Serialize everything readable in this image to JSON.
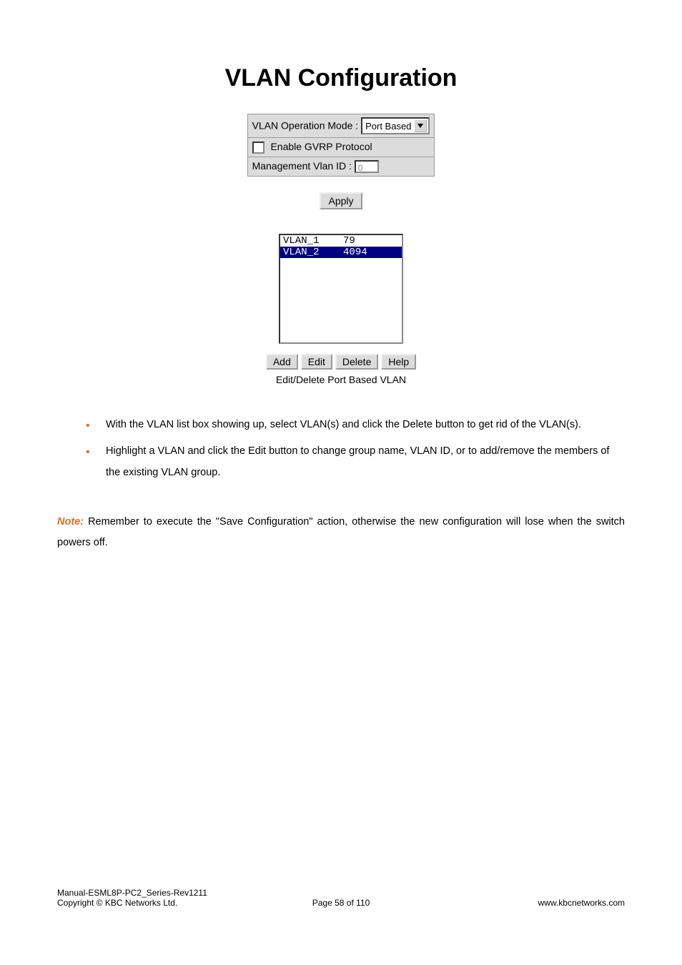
{
  "title": "VLAN Configuration",
  "config": {
    "op_mode_label": "VLAN Operation Mode :",
    "op_mode_value": "Port Based",
    "gvrp_label": "Enable GVRP Protocol",
    "gvrp_checked": false,
    "mvid_label": "Management Vlan ID :",
    "mvid_value": "0",
    "apply_label": "Apply"
  },
  "listbox": {
    "items": [
      {
        "text": "VLAN_1    79",
        "selected": false
      },
      {
        "text": "VLAN_2    4094",
        "selected": true
      }
    ]
  },
  "buttons": {
    "add": "Add",
    "edit": "Edit",
    "delete": "Delete",
    "help": "Help"
  },
  "caption": "Edit/Delete Port Based VLAN",
  "bullets": [
    "With the VLAN list box showing up, select VLAN(s) and click the Delete button to get rid of the VLAN(s).",
    "Highlight a VLAN and click the Edit button to change group name, VLAN ID, or to add/remove the members of the existing VLAN group."
  ],
  "note": {
    "label": "Note:",
    "text": "Remember to execute the \"Save Configuration\" action, otherwise the new configuration will lose when the switch powers off."
  },
  "footer": {
    "manual": "Manual-ESML8P-PC2_Series-Rev1211",
    "copyright": "Copyright © KBC Networks Ltd.",
    "page": "Page 58 of 110",
    "url": "www.kbcnetworks.com"
  }
}
